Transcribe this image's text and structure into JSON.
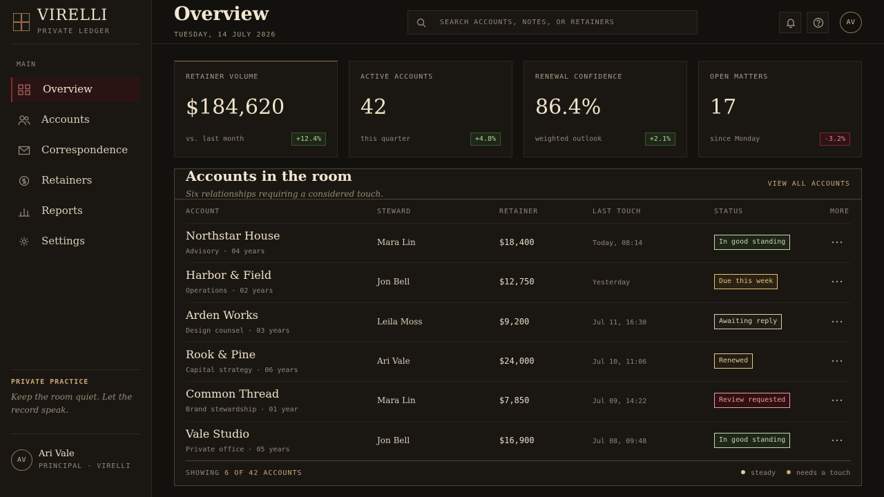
{
  "brand": {
    "name": "VIRELLI",
    "subtitle": "PRIVATE LEDGER"
  },
  "nav": {
    "section": "MAIN",
    "items": [
      {
        "label": "Overview",
        "icon": "grid-icon",
        "active": true
      },
      {
        "label": "Accounts",
        "icon": "users-icon",
        "active": false
      },
      {
        "label": "Correspondence",
        "icon": "mail-icon",
        "active": false
      },
      {
        "label": "Retainers",
        "icon": "coin-icon",
        "active": false
      },
      {
        "label": "Reports",
        "icon": "bar-chart-icon",
        "active": false
      },
      {
        "label": "Settings",
        "icon": "gear-icon",
        "active": false
      }
    ]
  },
  "practice": {
    "title": "PRIVATE PRACTICE",
    "quote": "Keep the room quiet. Let the record speak."
  },
  "user": {
    "initials": "AV",
    "name": "Ari Vale",
    "role": "PRINCIPAL · VIRELLI"
  },
  "header": {
    "title": "Overview",
    "date": "TUESDAY, 14 JULY 2026",
    "search_placeholder": "SEARCH ACCOUNTS, NOTES, OR RETAINERS",
    "avatar_initials": "AV"
  },
  "kpis": [
    {
      "label": "RETAINER VOLUME",
      "value": "$184,620",
      "sub": "vs. last month",
      "delta": "+12.4%",
      "trend": "up"
    },
    {
      "label": "ACTIVE ACCOUNTS",
      "value": "42",
      "sub": "this quarter",
      "delta": "+4.8%",
      "trend": "up"
    },
    {
      "label": "RENEWAL CONFIDENCE",
      "value": "86.4%",
      "sub": "weighted outlook",
      "delta": "+2.1%",
      "trend": "up"
    },
    {
      "label": "OPEN MATTERS",
      "value": "17",
      "sub": "since Monday",
      "delta": "-3.2%",
      "trend": "down"
    }
  ],
  "accounts": {
    "title": "Accounts in the room",
    "subtitle": "Six relationships requiring a considered touch.",
    "view_all": "VIEW ALL ACCOUNTS",
    "columns": {
      "account": "ACCOUNT",
      "steward": "STEWARD",
      "retainer": "RETAINER",
      "last_touch": "LAST TOUCH",
      "status": "STATUS",
      "more": "MORE"
    },
    "rows": [
      {
        "name": "Northstar House",
        "meta": "Advisory · 04 years",
        "steward": "Mara Lin",
        "retainer": "$18,400",
        "last_touch": "Today, 08:14",
        "status": "In good standing",
        "status_kind": "good"
      },
      {
        "name": "Harbor & Field",
        "meta": "Operations · 02 years",
        "steward": "Jon Bell",
        "retainer": "$12,750",
        "last_touch": "Yesterday",
        "status": "Due this week",
        "status_kind": "due"
      },
      {
        "name": "Arden Works",
        "meta": "Design counsel · 03 years",
        "steward": "Leila Moss",
        "retainer": "$9,200",
        "last_touch": "Jul 11, 16:30",
        "status": "Awaiting reply",
        "status_kind": "wait"
      },
      {
        "name": "Rook & Pine",
        "meta": "Capital strategy · 06 years",
        "steward": "Ari Vale",
        "retainer": "$24,000",
        "last_touch": "Jul 10, 11:06",
        "status": "Renewed",
        "status_kind": "renew"
      },
      {
        "name": "Common Thread",
        "meta": "Brand stewardship · 01 year",
        "steward": "Mara Lin",
        "retainer": "$7,850",
        "last_touch": "Jul 09, 14:22",
        "status": "Review requested",
        "status_kind": "review"
      },
      {
        "name": "Vale Studio",
        "meta": "Private office · 05 years",
        "steward": "Jon Bell",
        "retainer": "$16,900",
        "last_touch": "Jul 08, 09:48",
        "status": "In good standing",
        "status_kind": "good"
      }
    ],
    "footer": {
      "prefix": "SHOWING ",
      "count": "6 OF 42 ACCOUNTS"
    },
    "legend": [
      {
        "label": "steady",
        "color": "#c7d7a8"
      },
      {
        "label": "needs a touch",
        "color": "#c9a873"
      }
    ]
  },
  "colors": {
    "accent": "#c9a873",
    "brand_red": "#8c2a26",
    "background": "#13110e",
    "panel": "#1a1713"
  }
}
